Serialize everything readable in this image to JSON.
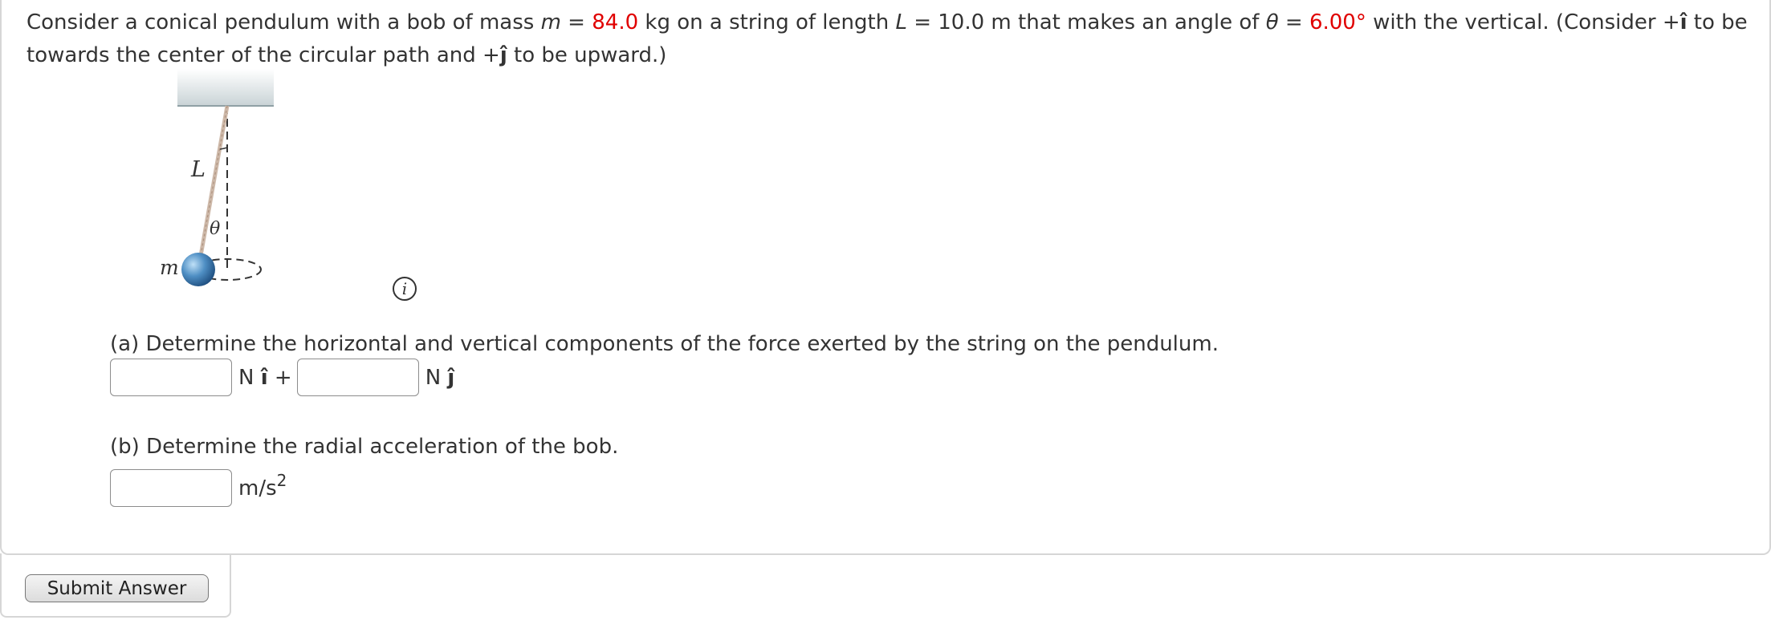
{
  "problem": {
    "text_1": "Consider a conical pendulum with a bob of mass ",
    "m_symbol": "m",
    "eq_1": " = ",
    "m_value": "84.0",
    "text_2": " kg on a string of length ",
    "L_symbol": "L",
    "text_3": " = 10.0 m that makes an angle of ",
    "theta_symbol": "θ",
    "eq_2": " = ",
    "theta_value": "6.00°",
    "text_4": " with the vertical. (Consider +",
    "i_hat": "î",
    "text_5": " to be towards the center of the circular path and +",
    "j_hat": "ĵ",
    "text_6": " to be upward.)"
  },
  "figure": {
    "length_label": "L",
    "angle_label": "θ",
    "mass_label": "m",
    "info_icon": "i"
  },
  "part_a": {
    "question": "(a) Determine the horizontal and vertical components of the force exerted by the string on the pendulum.",
    "unit_1": "N",
    "unit_1_vector": "î",
    "plus": "+",
    "unit_2": "N",
    "unit_2_vector": "ĵ",
    "input_1_value": "",
    "input_2_value": ""
  },
  "part_b": {
    "question": "(b) Determine the radial acceleration of the bob.",
    "unit": "m/s",
    "unit_exp": "2",
    "input_value": ""
  },
  "submit_label": "Submit Answer"
}
